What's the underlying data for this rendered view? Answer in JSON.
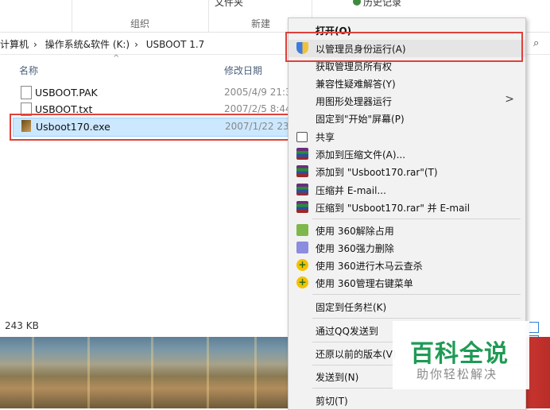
{
  "ribbon": {
    "group_organize": "组织",
    "group_new": "新建",
    "cut_label_folder": "文件夹",
    "cut_label_history": "历史记录"
  },
  "address": {
    "crumbs": [
      "计算机",
      "操作系统&软件 (K:)",
      "USBOOT 1.7"
    ]
  },
  "file_list": {
    "col_name": "名称",
    "col_date": "修改日期",
    "files": [
      {
        "name": "USBOOT.PAK",
        "date": "2005/4/9 21:3"
      },
      {
        "name": "USBOOT.txt",
        "date": "2007/2/5 8:44"
      },
      {
        "name": "Usboot170.exe",
        "date": "2007/1/22 23:"
      }
    ],
    "status": "243 KB"
  },
  "menu": {
    "items": [
      {
        "label": "打开(O)"
      },
      {
        "label": "以管理员身份运行(A)"
      },
      {
        "label": "获取管理员所有权"
      },
      {
        "label": "兼容性疑难解答(Y)"
      },
      {
        "label": "用图形处理器运行"
      },
      {
        "label": "固定到\"开始\"屏幕(P)"
      },
      {
        "label": "共享"
      },
      {
        "label": "添加到压缩文件(A)..."
      },
      {
        "label": "添加到 \"Usboot170.rar\"(T)"
      },
      {
        "label": "压缩并 E-mail..."
      },
      {
        "label": "压缩到 \"Usboot170.rar\" 并 E-mail"
      },
      {
        "label": "使用 360解除占用"
      },
      {
        "label": "使用 360强力删除"
      },
      {
        "label": "使用 360进行木马云查杀"
      },
      {
        "label": "使用 360管理右键菜单"
      },
      {
        "label": "固定到任务栏(K)"
      },
      {
        "label": "通过QQ发送到"
      },
      {
        "label": "还原以前的版本(V)"
      },
      {
        "label": "发送到(N)"
      },
      {
        "label": "剪切(T)"
      }
    ]
  },
  "watermark": {
    "title": "百科全说",
    "subtitle": "助你轻松解决"
  },
  "colors": {
    "highlight_box": "#e0403a",
    "selection": "#cce8ff",
    "watermark_green": "#1f9a55"
  }
}
